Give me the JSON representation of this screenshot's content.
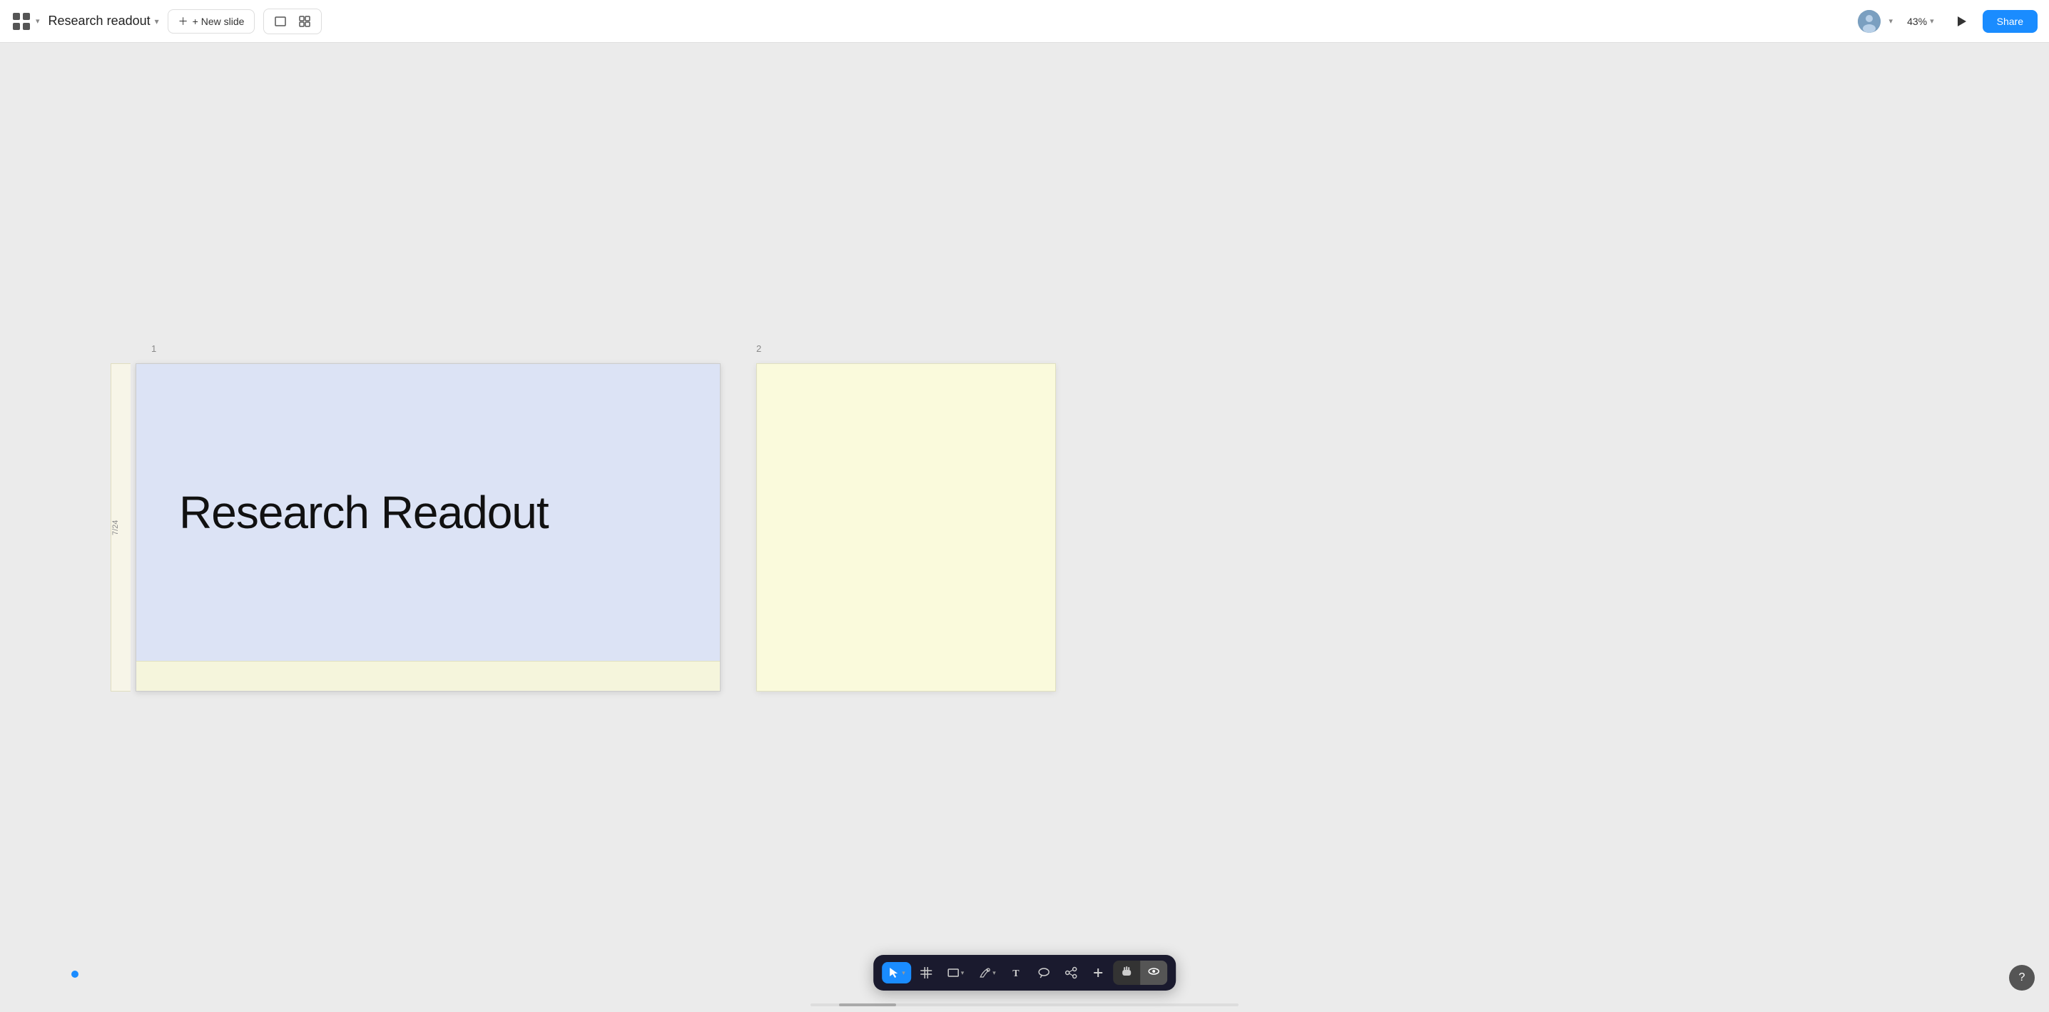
{
  "topbar": {
    "app_icon_label": "App",
    "doc_title": "Research readout",
    "doc_title_chevron": "▾",
    "new_slide_label": "+ New slide",
    "view_single_icon": "▭",
    "view_grid_icon": "⊞",
    "zoom_level": "43%",
    "zoom_chevron": "▾",
    "share_label": "Share"
  },
  "canvas": {
    "slide1": {
      "number": "1",
      "date_label": "7/24",
      "title": "Research Readout",
      "bg_color": "#dce3f5",
      "footer_color": "#f5f5dc"
    },
    "slide2": {
      "number": "2",
      "bg_color": "#fafadc"
    }
  },
  "toolbar": {
    "tools": [
      {
        "name": "select",
        "icon": "↖",
        "active": true,
        "has_chevron": true
      },
      {
        "name": "grid",
        "icon": "#",
        "active": false,
        "has_chevron": false
      },
      {
        "name": "shape",
        "icon": "▭",
        "active": false,
        "has_chevron": true
      },
      {
        "name": "pen",
        "icon": "✒",
        "active": false,
        "has_chevron": true
      },
      {
        "name": "text",
        "icon": "T",
        "active": false,
        "has_chevron": false
      },
      {
        "name": "comment",
        "icon": "○",
        "active": false,
        "has_chevron": false
      },
      {
        "name": "connect",
        "icon": "⚡",
        "active": false,
        "has_chevron": false
      },
      {
        "name": "more",
        "icon": "+",
        "active": false,
        "has_chevron": false
      }
    ],
    "view_toggle": {
      "hand_label": "✋",
      "pointer_label": "👁",
      "active": "pointer"
    }
  },
  "help": {
    "label": "?"
  }
}
